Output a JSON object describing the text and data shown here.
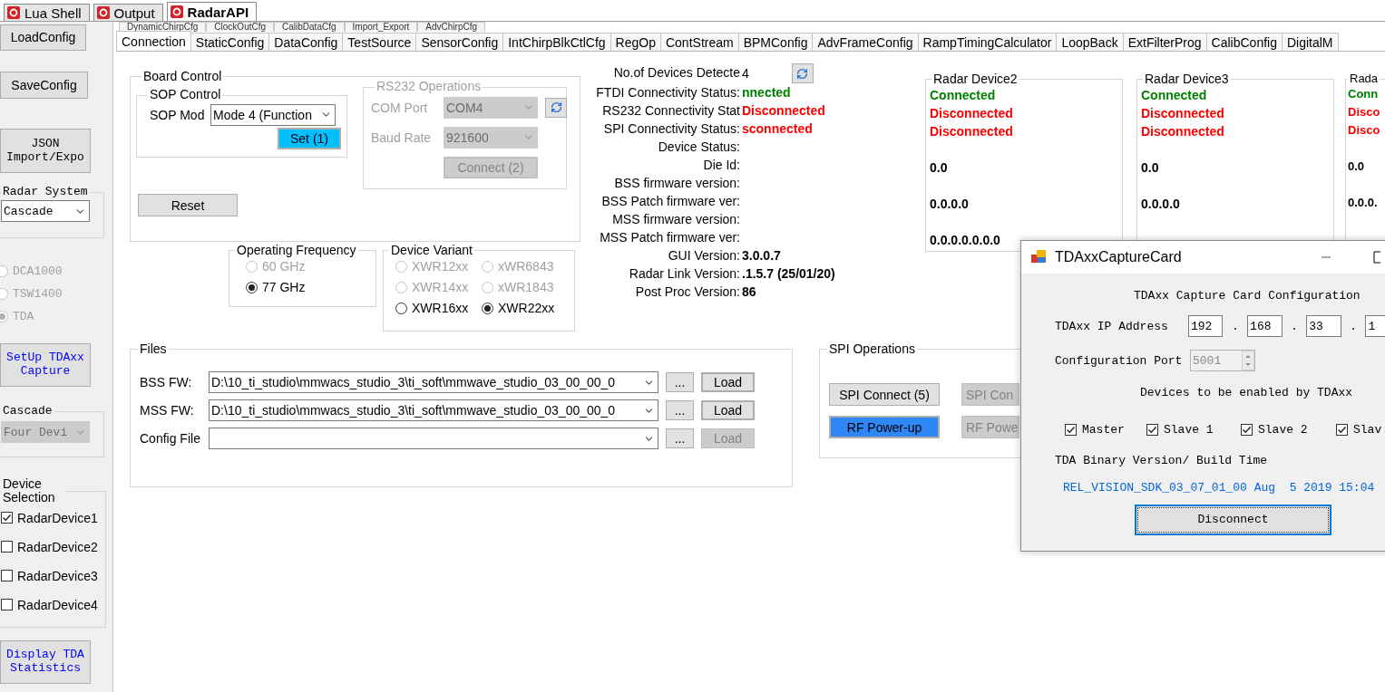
{
  "doc_tabs": [
    {
      "label": "Lua Shell",
      "selected": false
    },
    {
      "label": "Output",
      "selected": false
    },
    {
      "label": "RadarAPI",
      "selected": true
    }
  ],
  "sidebar": {
    "buttons": [
      {
        "label": "LoadConfig",
        "kind": "plain"
      },
      {
        "label": "SaveConfig",
        "kind": "plain"
      },
      {
        "label": "JSON Import/Expo",
        "kind": "mono"
      }
    ],
    "radar_system": {
      "title": "Radar System",
      "value": "Cascade",
      "disabled": false
    },
    "capture_options": [
      {
        "label": "DCA1000",
        "selected": false,
        "disabled": true
      },
      {
        "label": "TSW1400",
        "selected": false,
        "disabled": true
      },
      {
        "label": "TDA",
        "selected": true,
        "disabled": true
      }
    ],
    "setup_button": {
      "label": "SetUp TDAxx Capture",
      "kind": "mono-link"
    },
    "cascade": {
      "title": "Cascade",
      "value": "Four Devi",
      "disabled": true
    },
    "device_selection": {
      "title": "Device Selection",
      "devices": [
        {
          "label": "RadarDevice1",
          "checked": true
        },
        {
          "label": "RadarDevice2",
          "checked": false
        },
        {
          "label": "RadarDevice3",
          "checked": false
        },
        {
          "label": "RadarDevice4",
          "checked": false
        }
      ]
    },
    "stats_button": {
      "label": "Display TDA Statistics",
      "kind": "mono-link"
    }
  },
  "back_tabs": [
    "DynamicChirpCfg",
    "ClockOutCfg",
    "CalibDataCfg",
    "Import_Export",
    "AdvChirpCfg"
  ],
  "tabs": [
    {
      "label": "Connection",
      "selected": true
    },
    {
      "label": "StaticConfig",
      "selected": false
    },
    {
      "label": "DataConfig",
      "selected": false
    },
    {
      "label": "TestSource",
      "selected": false
    },
    {
      "label": "SensorConfig",
      "selected": false
    },
    {
      "label": "IntChirpBlkCtlCfg",
      "selected": false
    },
    {
      "label": "RegOp",
      "selected": false
    },
    {
      "label": "ContStream",
      "selected": false
    },
    {
      "label": "BPMConfig",
      "selected": false
    },
    {
      "label": "AdvFrameConfig",
      "selected": false
    },
    {
      "label": "RampTimingCalculator",
      "selected": false
    },
    {
      "label": "LoopBack",
      "selected": false
    },
    {
      "label": "ExtFilterProg",
      "selected": false
    },
    {
      "label": "CalibConfig",
      "selected": false
    },
    {
      "label": "DigitalM",
      "selected": false
    }
  ],
  "board_control": {
    "title": "Board Control",
    "sop": {
      "title": "SOP Control",
      "label": "SOP Mod",
      "value": "Mode 4 (Function",
      "button": {
        "label": "Set (1)",
        "kind": "accent"
      }
    },
    "rs232": {
      "title": "RS232 Operations",
      "disabled": true,
      "com_label": "COM Port",
      "com_value": "COM4",
      "baud_label": "Baud Rate",
      "baud_value": "921600",
      "connect": "Connect (2)"
    },
    "reset": "Reset"
  },
  "frequency": {
    "title": "Operating Frequency",
    "options": [
      {
        "label": "60 GHz",
        "selected": false,
        "disabled": true
      },
      {
        "label": "77 GHz",
        "selected": true,
        "disabled": false
      }
    ]
  },
  "device_variant": {
    "title": "Device Variant",
    "options": [
      {
        "label": "XWR12xx",
        "selected": false,
        "disabled": true
      },
      {
        "label": "xWR6843",
        "selected": false,
        "disabled": true
      },
      {
        "label": "XWR14xx",
        "selected": false,
        "disabled": true
      },
      {
        "label": "xWR1843",
        "selected": false,
        "disabled": true
      },
      {
        "label": "XWR16xx",
        "selected": false,
        "disabled": false
      },
      {
        "label": "XWR22xx",
        "selected": true,
        "disabled": false
      }
    ]
  },
  "status": [
    {
      "label": "No.of Devices Detecte",
      "value": "4",
      "kind": "count"
    },
    {
      "label": "FTDI Connectivity Status:",
      "value": "nnected",
      "kind": "ok"
    },
    {
      "label": "RS232 Connectivity Stat",
      "value": "Disconnected",
      "kind": "error"
    },
    {
      "label": "SPI Connectivity Status:",
      "value": "sconnected",
      "kind": "error"
    },
    {
      "label": "Device Status:"
    },
    {
      "label": "Die Id:"
    },
    {
      "label": "BSS firmware version:"
    },
    {
      "label": "BSS Patch firmware ver:"
    },
    {
      "label": "MSS firmware version:"
    },
    {
      "label": "MSS Patch firmware ver:"
    },
    {
      "label": "GUI Version:",
      "value": "3.0.0.7",
      "kind": "plain"
    },
    {
      "label": "Radar Link Version:",
      "value": ".1.5.7 (25/01/20)",
      "kind": "plain"
    },
    {
      "label": "Post Proc Version:",
      "value": "86",
      "kind": "plain"
    }
  ],
  "radar_devices": [
    {
      "title": "Radar Device2",
      "lines": [
        {
          "text": "Connected",
          "kind": "ok"
        },
        {
          "text": "Disconnected",
          "kind": "error"
        },
        {
          "text": "Disconnected",
          "kind": "error"
        },
        {
          "text": "0.0",
          "kind": "version"
        },
        {
          "text": "0.0.0.0",
          "kind": "version"
        },
        {
          "text": "0.0.0.0.0.0.0",
          "kind": "version"
        }
      ]
    },
    {
      "title": "Radar Device3",
      "lines": [
        {
          "text": "Connected",
          "kind": "ok"
        },
        {
          "text": "Disconnected",
          "kind": "error"
        },
        {
          "text": "Disconnected",
          "kind": "error"
        },
        {
          "text": "0.0",
          "kind": "version"
        },
        {
          "text": "0.0.0.0",
          "kind": "version"
        }
      ]
    },
    {
      "title": "Rada",
      "lines": [
        {
          "text": "Conn",
          "kind": "ok"
        },
        {
          "text": "Disco",
          "kind": "error"
        },
        {
          "text": "Disco",
          "kind": "error"
        },
        {
          "text": "0.0",
          "kind": "version"
        },
        {
          "text": "0.0.0.",
          "kind": "version"
        }
      ]
    }
  ],
  "files": {
    "title": "Files",
    "rows": [
      {
        "label": "BSS FW:",
        "value": "D:\\10_ti_studio\\mmwacs_studio_3\\ti_soft\\mmwave_studio_03_00_00_0",
        "browse": "...",
        "load": "Load",
        "load_enabled": true
      },
      {
        "label": "MSS FW:",
        "value": "D:\\10_ti_studio\\mmwacs_studio_3\\ti_soft\\mmwave_studio_03_00_00_0",
        "browse": "...",
        "load": "Load",
        "load_enabled": true
      },
      {
        "label": "Config File",
        "browse": "...",
        "load": "Load",
        "load_enabled": false
      }
    ]
  },
  "spi": {
    "title": "SPI Operations",
    "buttons": [
      {
        "label": "SPI Connect (5)",
        "kind": "normal"
      },
      {
        "label": "SPI Con",
        "kind": "disabled"
      },
      {
        "label": "RF Power-up",
        "kind": "primary"
      },
      {
        "label": "RF Powe",
        "kind": "disabled"
      }
    ]
  },
  "dialog": {
    "title": "TDAxxCaptureCard",
    "heading": "TDAxx Capture Card Configuration",
    "ip_label": "TDAxx IP Address",
    "ip": [
      "192",
      "168",
      "33",
      "1"
    ],
    "ip_separators": [
      ".",
      ".",
      "."
    ],
    "port_label": "Configuration Port",
    "port": "5001",
    "devices_label": "Devices to be enabled by TDAxx",
    "devices": [
      {
        "label": "Master",
        "checked": true
      },
      {
        "label": "Slave 1",
        "checked": true
      },
      {
        "label": "Slave 2",
        "checked": true
      },
      {
        "label": "Slav",
        "checked": true
      }
    ],
    "version_label": "TDA Binary Version/ Build Time",
    "version": "REL_VISION_SDK_03_07_01_00 Aug  5 2019 15:04",
    "button": "Disconnect"
  }
}
